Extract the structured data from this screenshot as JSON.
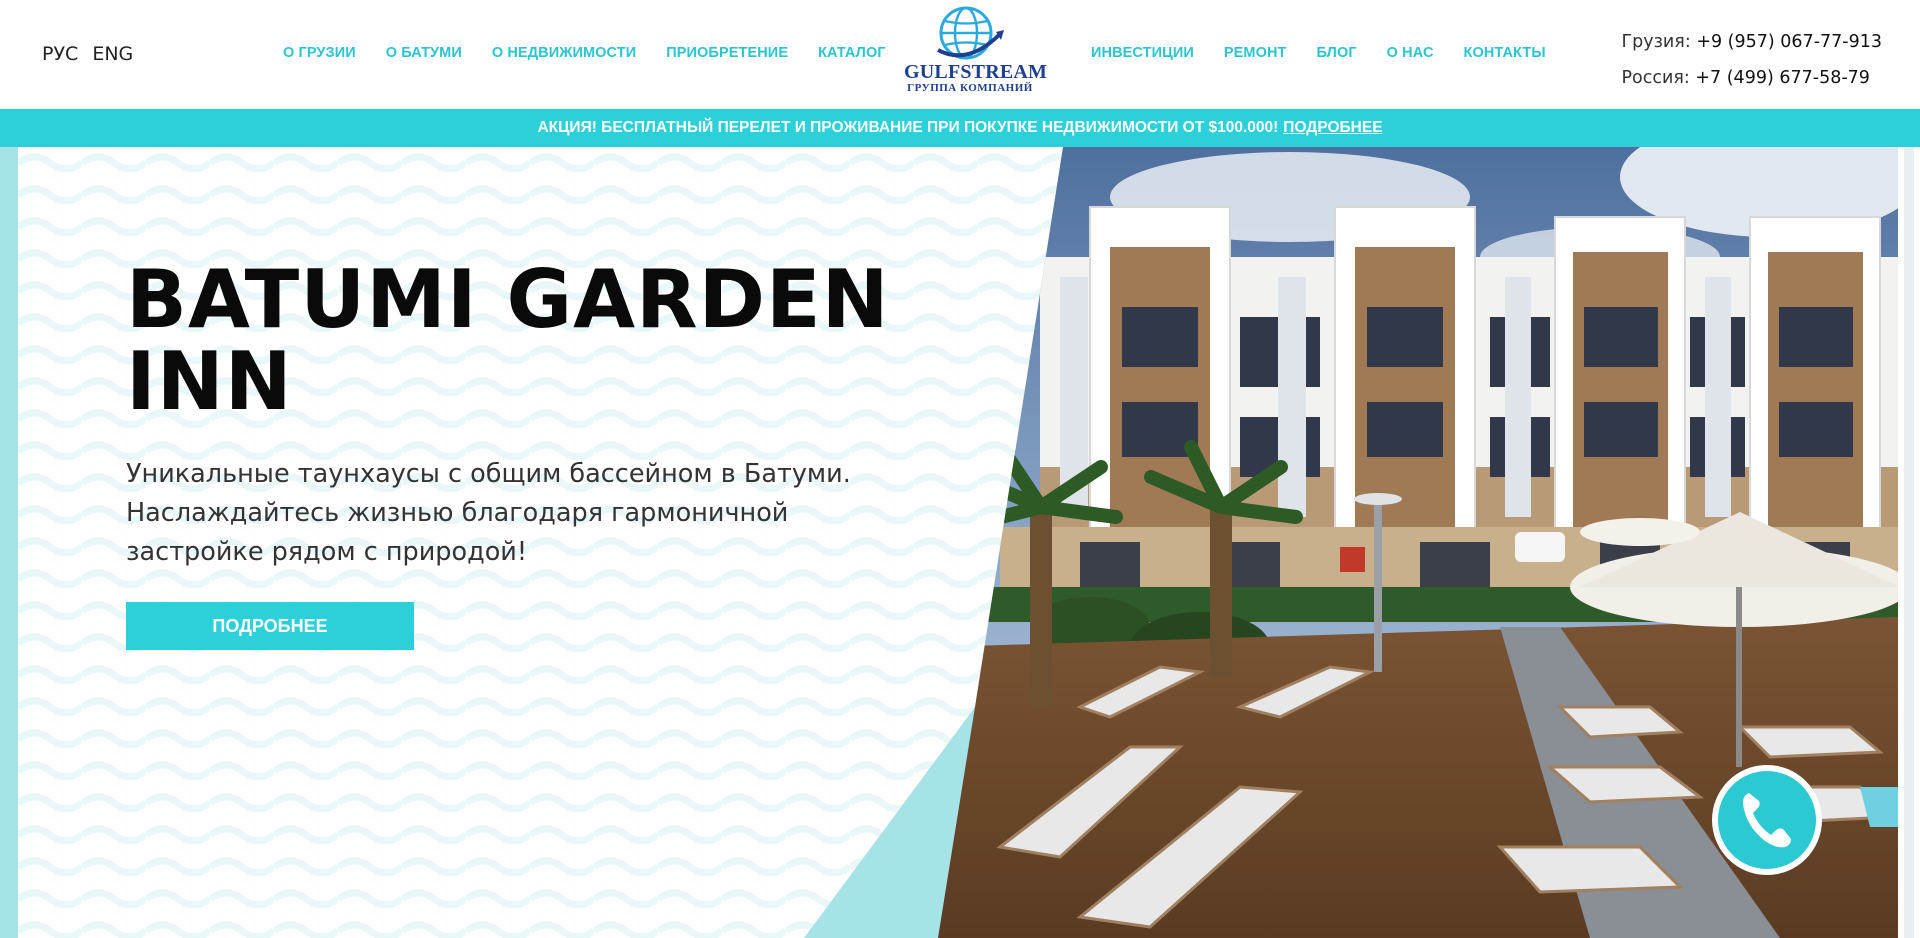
{
  "colors": {
    "accent": "#2bd0d9",
    "nav_text": "#2bc5cf",
    "logo_blue": "#1f3f8f",
    "light_teal": "#a6e3e6"
  },
  "header": {
    "languages": [
      "РУС",
      "ENG"
    ],
    "nav_left": [
      "О ГРУЗИИ",
      "О БАТУМИ",
      "О НЕДВИЖИМОСТИ",
      "ПРИОБРЕТЕНИЕ",
      "КАТАЛОГ"
    ],
    "nav_right": [
      "ИНВЕСТИЦИИ",
      "РЕМОНТ",
      "БЛОГ",
      "О НАС",
      "КОНТАКТЫ"
    ],
    "logo": {
      "name": "GULFSTREAM",
      "subtitle": "ГРУППА КОМПАНИЙ",
      "icon": "globe-icon"
    },
    "contacts": [
      {
        "label": "Грузия:",
        "phone": "+9 (957) 067-77-913"
      },
      {
        "label": "Россия:",
        "phone": "+7 (499) 677-58-79"
      }
    ]
  },
  "promo": {
    "text": "АКЦИЯ! БЕСПЛАТНЫЙ ПЕРЕЛЕТ И ПРОЖИВАНИЕ ПРИ ПОКУПКЕ НЕДВИЖИМОСТИ ОТ $100.000!",
    "link": "ПОДРОБНЕЕ"
  },
  "hero": {
    "title_line1": "BATUMI GARDEN",
    "title_line2": "INN",
    "description_line1": "Уникальные таунхаусы с общим бассейном в Батуми.",
    "description_line2": "Наслаждайтесь жизнью благодаря гармоничной",
    "description_line3": "застройке рядом с природой!",
    "button": "ПОДРОБНЕЕ",
    "image": "townhouse-complex-render",
    "call_icon": "phone-icon"
  }
}
